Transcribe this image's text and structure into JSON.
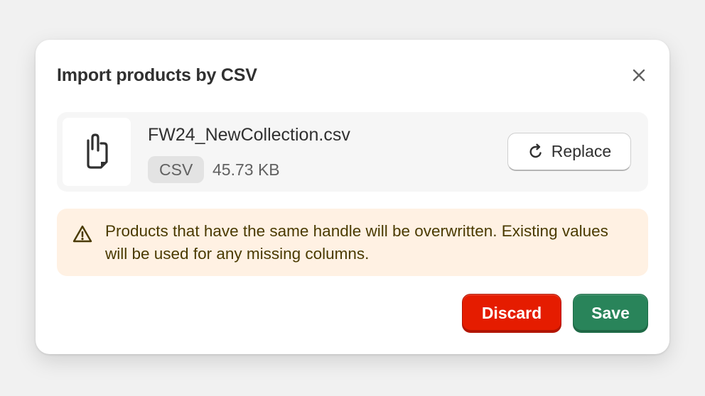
{
  "modal": {
    "title": "Import products by CSV",
    "close_icon": "close-icon"
  },
  "file": {
    "name": "FW24_NewCollection.csv",
    "type_badge": "CSV",
    "size": "45.73 KB",
    "thumb_icon": "file-attachment-icon",
    "replace_label": "Replace",
    "replace_icon": "refresh-icon"
  },
  "banner": {
    "icon": "warning-triangle-icon",
    "text": "Products that have the same handle will be overwritten. Existing values will be used for any missing columns.",
    "background": "#fff1e3"
  },
  "footer": {
    "discard_label": "Discard",
    "save_label": "Save",
    "discard_color": "#e51c00",
    "save_color": "#29845a"
  }
}
